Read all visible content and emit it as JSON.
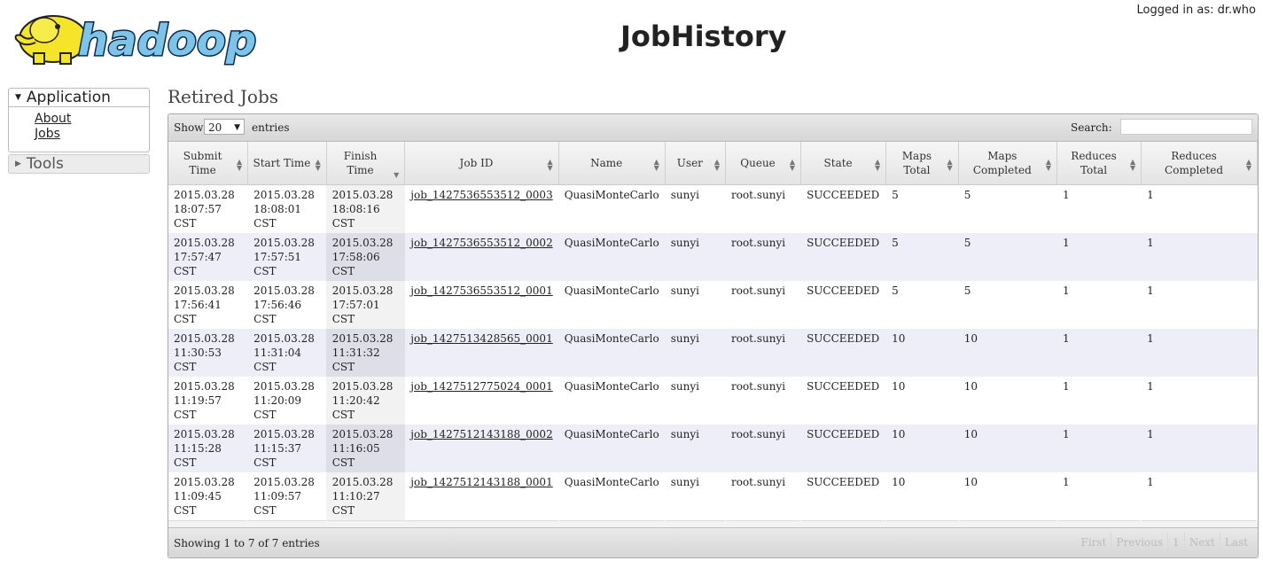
{
  "header": {
    "logo_text": "hadoop",
    "title": "JobHistory",
    "logged_in": "Logged in as: dr.who"
  },
  "sidebar": {
    "application": {
      "label": "Application",
      "links": [
        "About",
        "Jobs"
      ]
    },
    "tools": {
      "label": "Tools"
    }
  },
  "main": {
    "section_title": "Retired Jobs",
    "toolbar": {
      "show_label": "Show",
      "show_value": "20",
      "entries_label": "entries",
      "search_label": "Search:",
      "search_value": ""
    },
    "columns": [
      "Submit Time",
      "Start Time",
      "Finish Time",
      "Job ID",
      "Name",
      "User",
      "Queue",
      "State",
      "Maps Total",
      "Maps Completed",
      "Reduces Total",
      "Reduces Completed"
    ],
    "sorted_column": "Finish Time",
    "rows": [
      [
        "2015.03.28 18:07:57 CST",
        "2015.03.28 18:08:01 CST",
        "2015.03.28 18:08:16 CST",
        "job_1427536553512_0003",
        "QuasiMonteCarlo",
        "sunyi",
        "root.sunyi",
        "SUCCEEDED",
        "5",
        "5",
        "1",
        "1"
      ],
      [
        "2015.03.28 17:57:47 CST",
        "2015.03.28 17:57:51 CST",
        "2015.03.28 17:58:06 CST",
        "job_1427536553512_0002",
        "QuasiMonteCarlo",
        "sunyi",
        "root.sunyi",
        "SUCCEEDED",
        "5",
        "5",
        "1",
        "1"
      ],
      [
        "2015.03.28 17:56:41 CST",
        "2015.03.28 17:56:46 CST",
        "2015.03.28 17:57:01 CST",
        "job_1427536553512_0001",
        "QuasiMonteCarlo",
        "sunyi",
        "root.sunyi",
        "SUCCEEDED",
        "5",
        "5",
        "1",
        "1"
      ],
      [
        "2015.03.28 11:30:53 CST",
        "2015.03.28 11:31:04 CST",
        "2015.03.28 11:31:32 CST",
        "job_1427513428565_0001",
        "QuasiMonteCarlo",
        "sunyi",
        "root.sunyi",
        "SUCCEEDED",
        "10",
        "10",
        "1",
        "1"
      ],
      [
        "2015.03.28 11:19:57 CST",
        "2015.03.28 11:20:09 CST",
        "2015.03.28 11:20:42 CST",
        "job_1427512775024_0001",
        "QuasiMonteCarlo",
        "sunyi",
        "root.sunyi",
        "SUCCEEDED",
        "10",
        "10",
        "1",
        "1"
      ],
      [
        "2015.03.28 11:15:28 CST",
        "2015.03.28 11:15:37 CST",
        "2015.03.28 11:16:05 CST",
        "job_1427512143188_0002",
        "QuasiMonteCarlo",
        "sunyi",
        "root.sunyi",
        "SUCCEEDED",
        "10",
        "10",
        "1",
        "1"
      ],
      [
        "2015.03.28 11:09:45 CST",
        "2015.03.28 11:09:57 CST",
        "2015.03.28 11:10:27 CST",
        "job_1427512143188_0001",
        "QuasiMonteCarlo",
        "sunyi",
        "root.sunyi",
        "SUCCEEDED",
        "10",
        "10",
        "1",
        "1"
      ]
    ],
    "filter_placeholders": [
      "Submit Time",
      "Start Time",
      "Finish Time",
      "Job ID",
      "Name",
      "User",
      "Queue",
      "State",
      "Maps Total",
      "Maps Completed",
      "Reduces Total",
      "Reduces Completed"
    ],
    "footer": {
      "info": "Showing 1 to 7 of 7 entries",
      "pager": [
        "First",
        "Previous",
        "1",
        "Next",
        "Last"
      ]
    }
  }
}
